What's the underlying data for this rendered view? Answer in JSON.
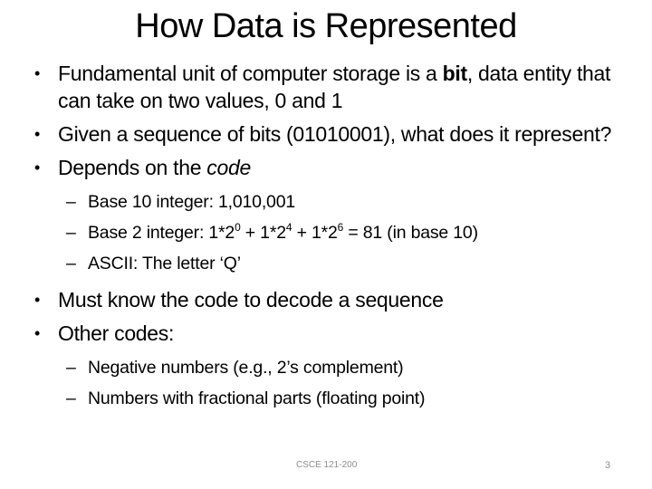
{
  "slide": {
    "title": "How Data is Represented",
    "bullet_glyph": "•",
    "dash_glyph": "–",
    "bullets": [
      {
        "parts": [
          {
            "text": "Fundamental unit of computer storage is a ",
            "style": "normal"
          },
          {
            "text": "bit",
            "style": "bold"
          },
          {
            "text": ", data entity that can take on two values, 0 and 1",
            "style": "normal"
          }
        ]
      },
      {
        "parts": [
          {
            "text": "Given a sequence of bits (01010001), what does it represent?",
            "style": "normal"
          }
        ]
      },
      {
        "parts": [
          {
            "text": "Depends on the ",
            "style": "normal"
          },
          {
            "text": "code",
            "style": "italic"
          }
        ],
        "sub_items": [
          {
            "text": "Base 10 integer: 1,010,001"
          },
          {
            "prefix": "Base 2 integer: 1*2",
            "exp1": "0",
            "mid1": " + 1*2",
            "exp2": "4",
            "mid2": " + 1*2",
            "exp3": "6",
            "suffix": " = 81 (in base 10)"
          },
          {
            "text": "ASCII: The letter ‘Q’"
          }
        ]
      },
      {
        "parts": [
          {
            "text": "Must know the code to decode a sequence",
            "style": "normal"
          }
        ]
      },
      {
        "parts": [
          {
            "text": "Other codes:",
            "style": "normal"
          }
        ],
        "sub_items": [
          {
            "text": "Negative numbers (e.g., 2’s complement)"
          },
          {
            "text": "Numbers with fractional parts (floating point)"
          }
        ]
      }
    ],
    "footer": {
      "course": "CSCE 121-200",
      "page_number": "3"
    }
  }
}
